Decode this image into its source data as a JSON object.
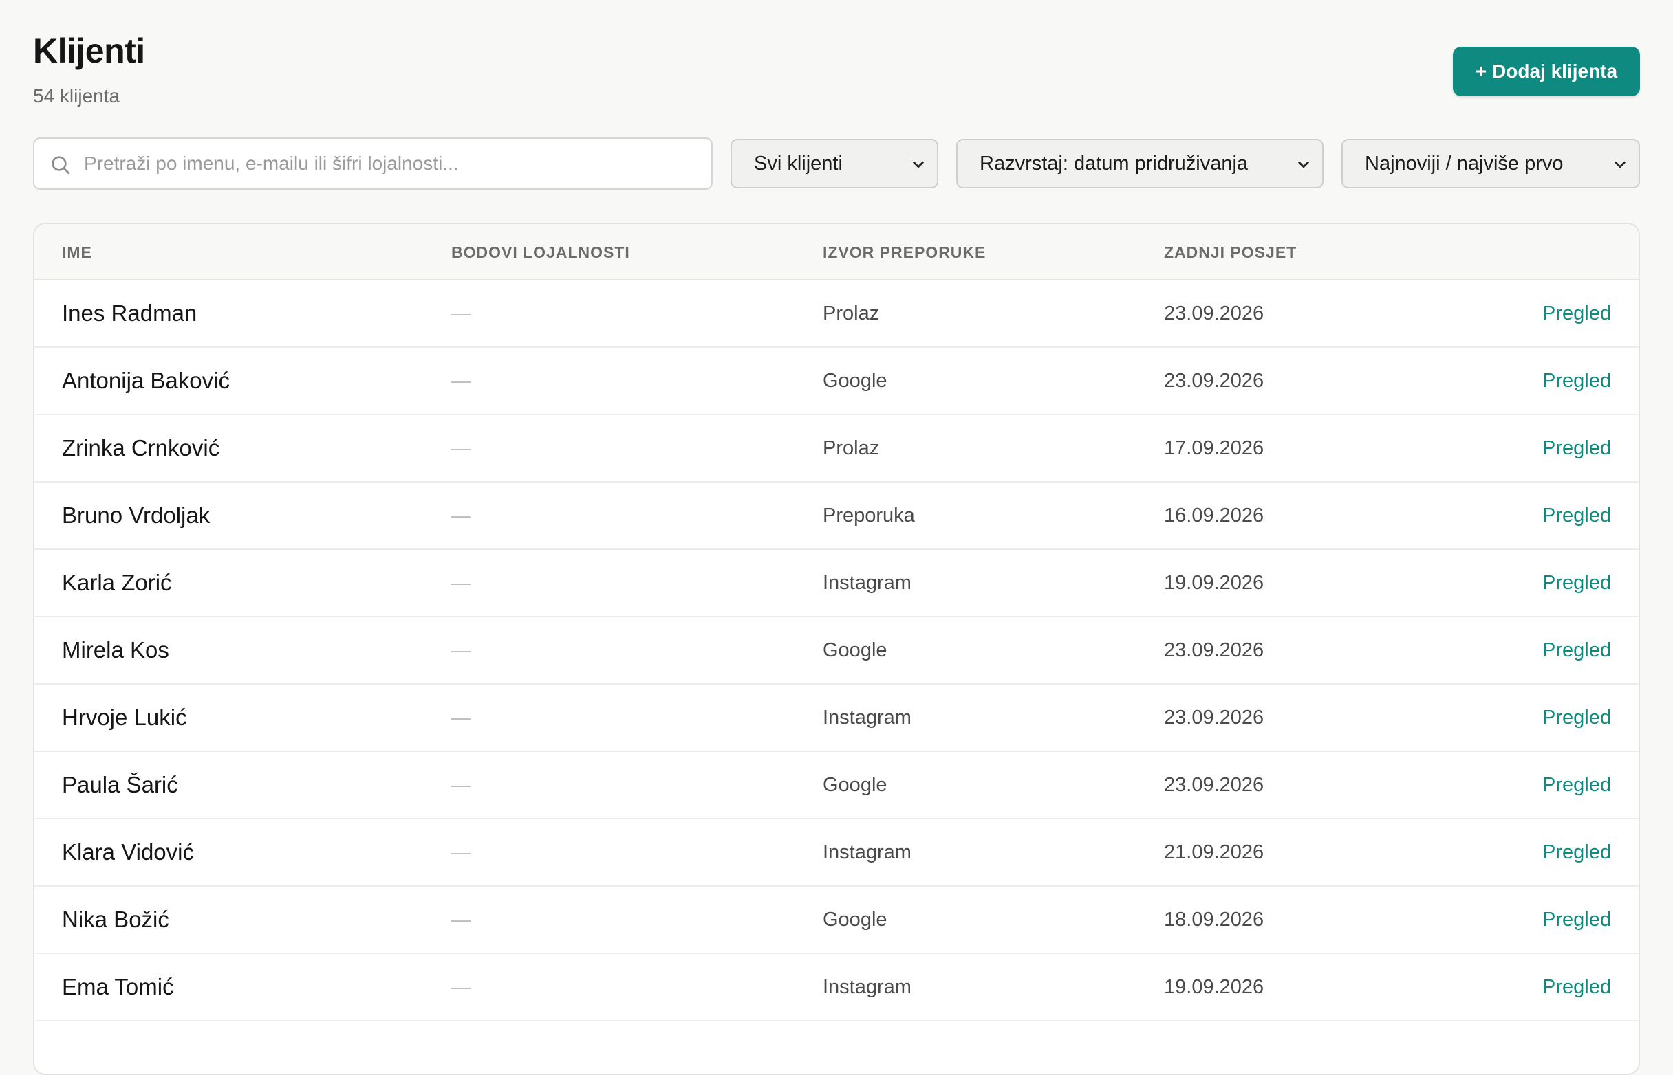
{
  "header": {
    "title": "Klijenti",
    "subtitle": "54 klijenta",
    "add_button_label": "+ Dodaj klijenta"
  },
  "toolbar": {
    "search": {
      "placeholder": "Pretraži po imenu, e-mailu ili šifri lojalnosti...",
      "value": "",
      "icon": "search-icon"
    },
    "filter_select": {
      "selected": "Svi klijenti"
    },
    "sort_select": {
      "selected": "Razvrstaj: datum pridruživanja"
    },
    "order_select": {
      "selected": "Najnoviji / najviše prvo"
    }
  },
  "table": {
    "columns": {
      "name": "IME",
      "points": "BODOVI LOJALNOSTI",
      "source": "IZVOR PREPORUKE",
      "last_visit": "ZADNJI POSJET"
    },
    "rows": [
      {
        "name": "Ines Radman",
        "points": "—",
        "source": "Prolaz",
        "last_visit": "23.09.2026",
        "action": "Pregled"
      },
      {
        "name": "Antonija Baković",
        "points": "—",
        "source": "Google",
        "last_visit": "23.09.2026",
        "action": "Pregled"
      },
      {
        "name": "Zrinka Crnković",
        "points": "—",
        "source": "Prolaz",
        "last_visit": "17.09.2026",
        "action": "Pregled"
      },
      {
        "name": "Bruno Vrdoljak",
        "points": "—",
        "source": "Preporuka",
        "last_visit": "16.09.2026",
        "action": "Pregled"
      },
      {
        "name": "Karla Zorić",
        "points": "—",
        "source": "Instagram",
        "last_visit": "19.09.2026",
        "action": "Pregled"
      },
      {
        "name": "Mirela Kos",
        "points": "—",
        "source": "Google",
        "last_visit": "23.09.2026",
        "action": "Pregled"
      },
      {
        "name": "Hrvoje Lukić",
        "points": "—",
        "source": "Instagram",
        "last_visit": "23.09.2026",
        "action": "Pregled"
      },
      {
        "name": "Paula Šarić",
        "points": "—",
        "source": "Google",
        "last_visit": "23.09.2026",
        "action": "Pregled"
      },
      {
        "name": "Klara Vidović",
        "points": "—",
        "source": "Instagram",
        "last_visit": "21.09.2026",
        "action": "Pregled"
      },
      {
        "name": "Nika Božić",
        "points": "—",
        "source": "Google",
        "last_visit": "18.09.2026",
        "action": "Pregled"
      },
      {
        "name": "Ema Tomić",
        "points": "—",
        "source": "Instagram",
        "last_visit": "19.09.2026",
        "action": "Pregled"
      }
    ]
  },
  "colors": {
    "accent": "#0f8a80",
    "background": "#f8f8f7",
    "muted_text": "#6b6b6b"
  }
}
